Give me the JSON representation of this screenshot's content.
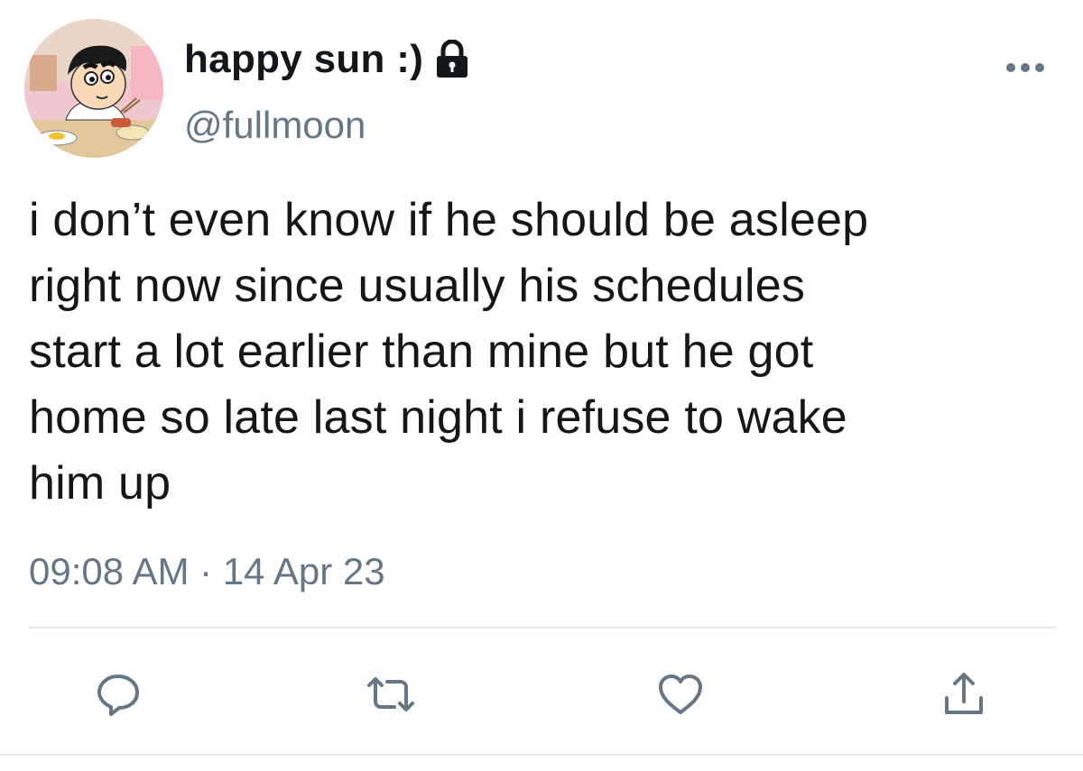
{
  "user": {
    "display_name": "happy sun :)",
    "handle": "@fullmoon",
    "avatar_icon": "cartoon-avatar",
    "protected_icon": "lock-icon"
  },
  "tweet": {
    "lines": [
      "i don’t even know if he should be asleep",
      "right now since usually his schedules",
      "start a lot earlier than mine but he got",
      "home so late last night i refuse to wake",
      "him up"
    ],
    "time": "09:08 AM",
    "separator": "·",
    "date": "14 Apr 23"
  },
  "actions": {
    "reply_icon": "reply-icon",
    "retweet_icon": "retweet-icon",
    "like_icon": "heart-icon",
    "share_icon": "share-icon"
  },
  "colors": {
    "text": "#14171a",
    "secondary": "#657786",
    "icon": "#657786",
    "divider": "#e1e8ed"
  }
}
